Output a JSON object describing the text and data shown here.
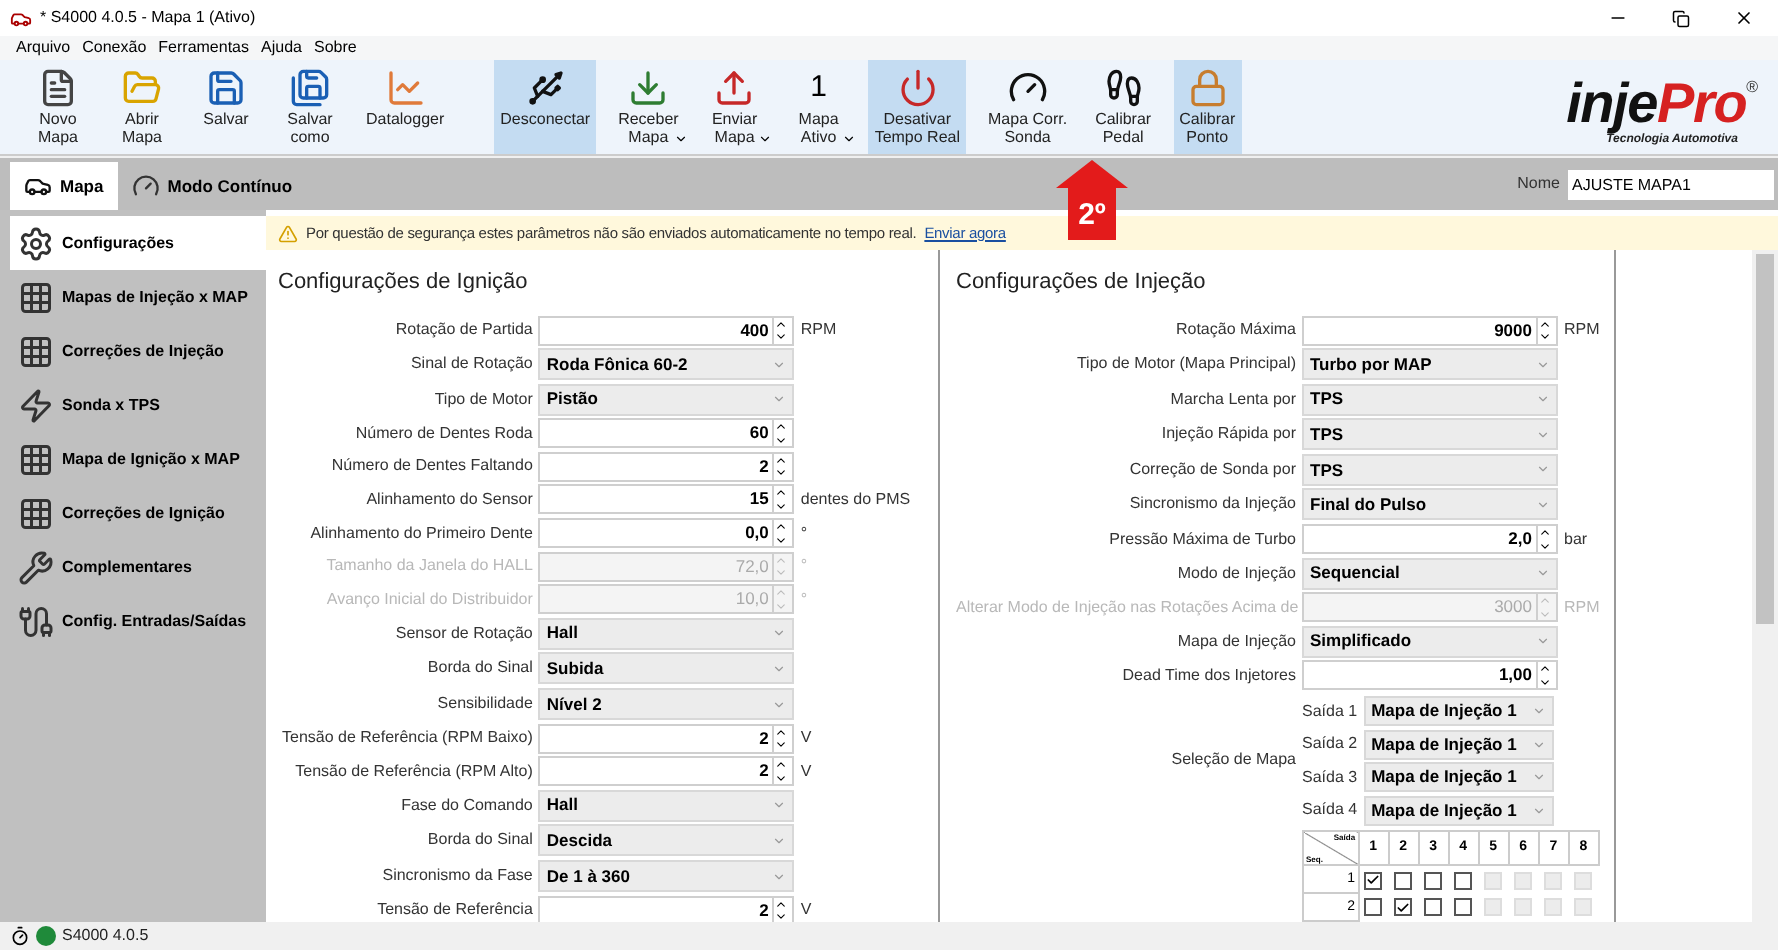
{
  "window": {
    "title": "* S4000 4.0.5 - Mapa 1 (Ativo)"
  },
  "menu": [
    "Arquivo",
    "Conexão",
    "Ferramentas",
    "Ajuda",
    "Sobre"
  ],
  "toolbar": [
    {
      "label": "Novo\nMapa",
      "selected": false,
      "dropdown": false
    },
    {
      "label": "Abrir\nMapa",
      "selected": false,
      "dropdown": false
    },
    {
      "label": "Salvar",
      "selected": false,
      "dropdown": false
    },
    {
      "label": "Salvar\ncomo",
      "selected": false,
      "dropdown": false
    },
    {
      "label": "Datalogger",
      "selected": false,
      "dropdown": false
    },
    {
      "label": "Desconectar",
      "selected": true,
      "dropdown": false
    },
    {
      "label": "Receber\nMapa",
      "selected": false,
      "dropdown": true
    },
    {
      "label": "Enviar\nMapa",
      "selected": false,
      "dropdown": true
    },
    {
      "label": "Mapa\nAtivo",
      "selected": false,
      "dropdown": true,
      "icon_text": "1"
    },
    {
      "label": "Desativar\nTempo Real",
      "selected": true,
      "dropdown": false
    },
    {
      "label": "Mapa Corr.\nSonda",
      "selected": false,
      "dropdown": false
    },
    {
      "label": "Calibrar\nPedal",
      "selected": false,
      "dropdown": false
    },
    {
      "label": "Calibrar\nPonto",
      "selected": true,
      "dropdown": false
    }
  ],
  "logo": {
    "brand_left": "inje",
    "brand_right": "Pro",
    "registered": "®",
    "tagline": "Tecnologia Automotiva"
  },
  "tabs": [
    {
      "label": "Mapa",
      "selected": true
    },
    {
      "label": "Modo Contínuo",
      "selected": false
    }
  ],
  "name_field": {
    "label": "Nome",
    "value": "AJUSTE MAPA1"
  },
  "sidebar": [
    {
      "label": "Configurações",
      "selected": true
    },
    {
      "label": "Mapas de Injeção x MAP",
      "selected": false
    },
    {
      "label": "Correções de Injeção",
      "selected": false
    },
    {
      "label": "Sonda x TPS",
      "selected": false
    },
    {
      "label": "Mapa de Ignição x MAP",
      "selected": false
    },
    {
      "label": "Correções de Ignição",
      "selected": false
    },
    {
      "label": "Complementares",
      "selected": false
    },
    {
      "label": "Config. Entradas/Saídas",
      "selected": false
    }
  ],
  "warning": {
    "text": "Por questão de segurança estes parâmetros não são enviados automaticamente no tempo real.",
    "link": "Enviar agora"
  },
  "ignition": {
    "title": "Configurações de Ignição",
    "fields": [
      {
        "label": "Rotação de Partida",
        "kind": "spin",
        "value": "400",
        "unit": "RPM",
        "disabled": false
      },
      {
        "label": "Sinal de Rotação",
        "kind": "select",
        "value": "Roda Fônica 60-2",
        "disabled": false
      },
      {
        "label": "Tipo de Motor",
        "kind": "select",
        "value": "Pistão",
        "disabled": false
      },
      {
        "label": "Número de Dentes Roda",
        "kind": "spin",
        "value": "60",
        "disabled": false
      },
      {
        "label": "Número de Dentes Faltando",
        "kind": "spin",
        "value": "2",
        "disabled": false
      },
      {
        "label": "Alinhamento do Sensor",
        "kind": "spin",
        "value": "15",
        "unit": "dentes do PMS",
        "disabled": false
      },
      {
        "label": "Alinhamento do Primeiro Dente",
        "kind": "spin",
        "value": "0,0",
        "unit": "°",
        "disabled": false
      },
      {
        "label": "Tamanho da Janela do HALL",
        "kind": "spin",
        "value": "72,0",
        "unit": "°",
        "disabled": true
      },
      {
        "label": "Avanço Inicial do Distribuidor",
        "kind": "spin",
        "value": "10,0",
        "unit": "°",
        "disabled": true
      },
      {
        "label": "Sensor de Rotação",
        "kind": "select",
        "value": "Hall",
        "disabled": false
      },
      {
        "label": "Borda do Sinal",
        "kind": "select",
        "value": "Subida",
        "disabled": false
      },
      {
        "label": "Sensibilidade",
        "kind": "select",
        "value": "Nível 2",
        "disabled": false
      },
      {
        "label": "Tensão de Referência (RPM Baixo)",
        "kind": "spin",
        "value": "2",
        "unit": "V",
        "disabled": false
      },
      {
        "label": "Tensão de Referência (RPM Alto)",
        "kind": "spin",
        "value": "2",
        "unit": "V",
        "disabled": false
      },
      {
        "label": "Fase do Comando",
        "kind": "select",
        "value": "Hall",
        "disabled": false
      },
      {
        "label": "Borda do Sinal",
        "kind": "select",
        "value": "Descida",
        "disabled": false
      },
      {
        "label": "Sincronismo da Fase",
        "kind": "select",
        "value": "De 1 à 360",
        "disabled": false
      },
      {
        "label": "Tensão de Referência",
        "kind": "spin",
        "value": "2",
        "unit": "V",
        "disabled": false
      }
    ]
  },
  "injection": {
    "title": "Configurações de Injeção",
    "fields": [
      {
        "label": "Rotação Máxima",
        "kind": "spin",
        "value": "9000",
        "unit": "RPM",
        "disabled": false
      },
      {
        "label": "Tipo de Motor (Mapa Principal)",
        "kind": "select",
        "value": "Turbo por MAP",
        "disabled": false
      },
      {
        "label": "Marcha Lenta por",
        "kind": "select",
        "value": "TPS",
        "disabled": false
      },
      {
        "label": "Injeção Rápida por",
        "kind": "select",
        "value": "TPS",
        "disabled": false
      },
      {
        "label": "Correção de Sonda por",
        "kind": "select",
        "value": "TPS",
        "disabled": false
      },
      {
        "label": "Sincronismo da Injeção",
        "kind": "select",
        "value": "Final do Pulso",
        "disabled": false
      },
      {
        "label": "Pressão Máxima de Turbo",
        "kind": "spin",
        "value": "2,0",
        "unit": "bar",
        "disabled": false
      },
      {
        "label": "Modo de Injeção",
        "kind": "select",
        "value": "Sequencial",
        "disabled": false
      },
      {
        "label": "Alterar Modo de Injeção nas Rotações Acima de",
        "kind": "spin",
        "value": "3000",
        "unit": "RPM",
        "disabled": true
      },
      {
        "label": "Mapa de Injeção",
        "kind": "select",
        "value": "Simplificado",
        "disabled": false
      },
      {
        "label": "Dead Time dos Injetores",
        "kind": "spin",
        "value": "1,00",
        "disabled": false
      }
    ],
    "map_selection": {
      "label": "Seleção de Mapa",
      "outputs": [
        {
          "label": "Saída 1",
          "value": "Mapa de Injeção 1"
        },
        {
          "label": "Saída 2",
          "value": "Mapa de Injeção 1"
        },
        {
          "label": "Saída 3",
          "value": "Mapa de Injeção 1"
        },
        {
          "label": "Saída 4",
          "value": "Mapa de Injeção 1"
        }
      ]
    },
    "sequence_table": {
      "corner_top": "Saída",
      "corner_bottom": "Seq.",
      "columns": [
        "1",
        "2",
        "3",
        "4",
        "5",
        "6",
        "7",
        "8"
      ],
      "rows": [
        {
          "label": "1",
          "cells": [
            {
              "checked": true,
              "disabled": false
            },
            {
              "checked": false,
              "disabled": false
            },
            {
              "checked": false,
              "disabled": false
            },
            {
              "checked": false,
              "disabled": false
            },
            {
              "checked": false,
              "disabled": true
            },
            {
              "checked": false,
              "disabled": true
            },
            {
              "checked": false,
              "disabled": true
            },
            {
              "checked": false,
              "disabled": true
            }
          ]
        },
        {
          "label": "2",
          "cells": [
            {
              "checked": false,
              "disabled": false
            },
            {
              "checked": true,
              "disabled": false
            },
            {
              "checked": false,
              "disabled": false
            },
            {
              "checked": false,
              "disabled": false
            },
            {
              "checked": false,
              "disabled": true
            },
            {
              "checked": false,
              "disabled": true
            },
            {
              "checked": false,
              "disabled": true
            },
            {
              "checked": false,
              "disabled": true
            }
          ]
        }
      ]
    }
  },
  "annotation": {
    "label": "2º"
  },
  "status_bar": {
    "connected": true,
    "text": "S4000 4.0.5"
  }
}
